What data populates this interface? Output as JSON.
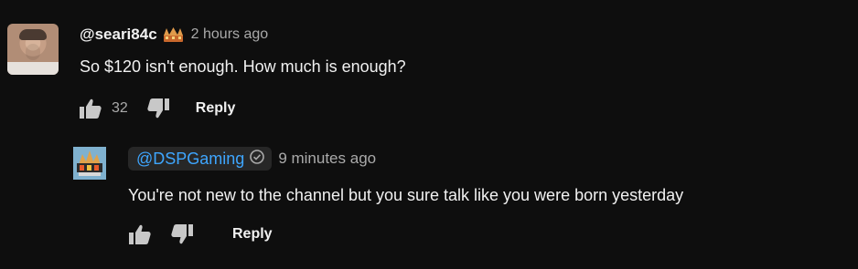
{
  "comments": [
    {
      "author": "@seari84c",
      "badge_icon": "crown-icon",
      "time": "2 hours ago",
      "text": "So $120 isn't enough. How much is enough?",
      "likes": "32",
      "reply_label": "Reply"
    },
    {
      "author": "@DSPGaming",
      "author_color": "#3ea6ff",
      "verified_icon": "verified-check-icon",
      "time": "9 minutes ago",
      "text": "You're not new to the channel but you sure talk like you were born yesterday",
      "reply_label": "Reply"
    }
  ]
}
